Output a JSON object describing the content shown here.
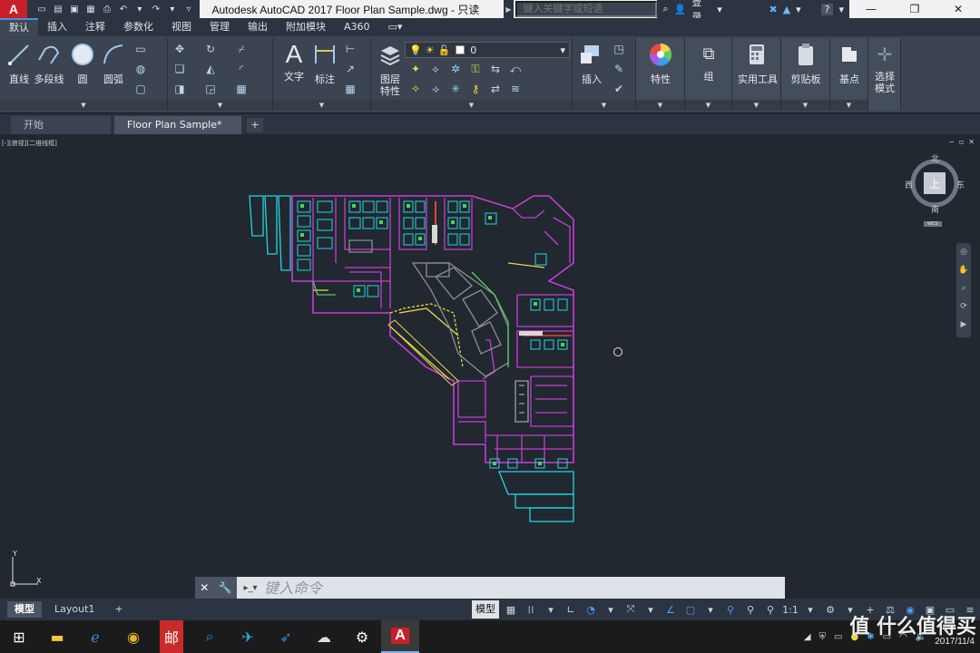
{
  "titlebar": {
    "logo": "A",
    "title": "Autodesk AutoCAD 2017    Floor Plan Sample.dwg - 只读",
    "search_placeholder": "键入关键字或短语",
    "login": "登录",
    "help": "?"
  },
  "ribbon_tabs": [
    "默认",
    "插入",
    "注释",
    "参数化",
    "视图",
    "管理",
    "输出",
    "附加模块",
    "A360"
  ],
  "ribbon": {
    "draw": [
      "直线",
      "多段线",
      "圆",
      "圆弧"
    ],
    "annotation": [
      "文字",
      "标注"
    ],
    "layers": {
      "label": "图层\n特性",
      "current": "0"
    },
    "block": "插入",
    "properties": "特性",
    "group": "组",
    "utilities": "实用工具",
    "clipboard": "剪贴板",
    "view": "基点",
    "select": "选择\n模式"
  },
  "doc_tabs": {
    "start": "开始",
    "active": "Floor Plan Sample*",
    "plus": "+"
  },
  "viewport": {
    "label": "[-][俯视][二维线框]",
    "viewcube": {
      "north": "北",
      "south": "南",
      "east": "东",
      "west": "西",
      "face": "上",
      "wcs": "WCS"
    },
    "ucs": {
      "x": "X",
      "y": "Y"
    }
  },
  "command": {
    "placeholder": "键入命令"
  },
  "status": {
    "tabs": [
      "模型",
      "Layout1"
    ],
    "plus": "+",
    "model_label": "模型",
    "scale": "1:1"
  },
  "taskbar": {
    "date": "2017/11/4",
    "watermark": "值 什么值得买"
  },
  "colors": {
    "accent": "#4a90d9",
    "plan_magenta": "#c83cd6",
    "plan_cyan": "#27d3e0",
    "plan_green": "#4fd15b",
    "plan_yellow": "#e7d84a"
  }
}
